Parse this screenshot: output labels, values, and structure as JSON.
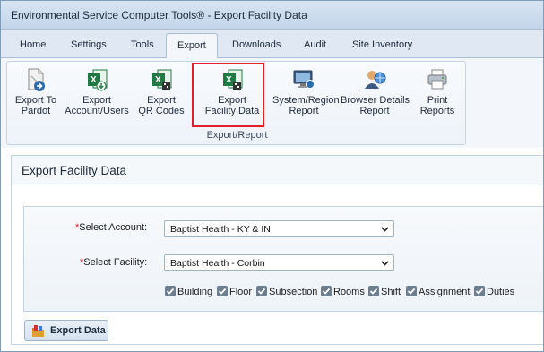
{
  "window": {
    "title": "Environmental Service Computer Tools® - Export Facility Data"
  },
  "tabs": [
    {
      "label": "Home",
      "active": false
    },
    {
      "label": "Settings",
      "active": false
    },
    {
      "label": "Tools",
      "active": false
    },
    {
      "label": "Export",
      "active": true
    },
    {
      "label": "Downloads",
      "active": false
    },
    {
      "label": "Audit",
      "active": false
    },
    {
      "label": "Site Inventory",
      "active": false
    }
  ],
  "ribbon": {
    "group_label": "Export/Report",
    "buttons": [
      {
        "line1": "Export To",
        "line2": "Pardot",
        "icon": "document-export-icon"
      },
      {
        "line1": "Export",
        "line2": "Account/Users",
        "icon": "excel-icon"
      },
      {
        "line1": "Export",
        "line2": "QR Codes",
        "icon": "excel-icon"
      },
      {
        "line1": "Export",
        "line2": "Facility Data",
        "icon": "excel-icon",
        "highlighted": true
      },
      {
        "line1": "System/Region",
        "line2": "Report",
        "icon": "monitor-icon"
      },
      {
        "line1": "Browser Details",
        "line2": "Report",
        "icon": "user-globe-icon"
      },
      {
        "line1": "Print",
        "line2": "Reports",
        "icon": "printer-icon"
      }
    ]
  },
  "panel": {
    "title": "Export Facility Data",
    "account": {
      "required_mark": "*",
      "label": "Select Account:",
      "value": "Baptist Health - KY & IN"
    },
    "facility": {
      "required_mark": "*",
      "label": "Select Facility:",
      "value": "Baptist Health - Corbin"
    },
    "checkboxes": [
      {
        "label": "Building",
        "checked": true
      },
      {
        "label": "Floor",
        "checked": true
      },
      {
        "label": "Subsection",
        "checked": true
      },
      {
        "label": "Rooms",
        "checked": true
      },
      {
        "label": "Shift",
        "checked": true
      },
      {
        "label": "Assignment",
        "checked": true
      },
      {
        "label": "Duties",
        "checked": true
      }
    ],
    "export_button": "Export Data"
  },
  "colors": {
    "highlight": "#e3202a",
    "required": "#e3202a",
    "excel_green": "#1f7a44",
    "checkbox_fill": "#6d7f8f"
  }
}
